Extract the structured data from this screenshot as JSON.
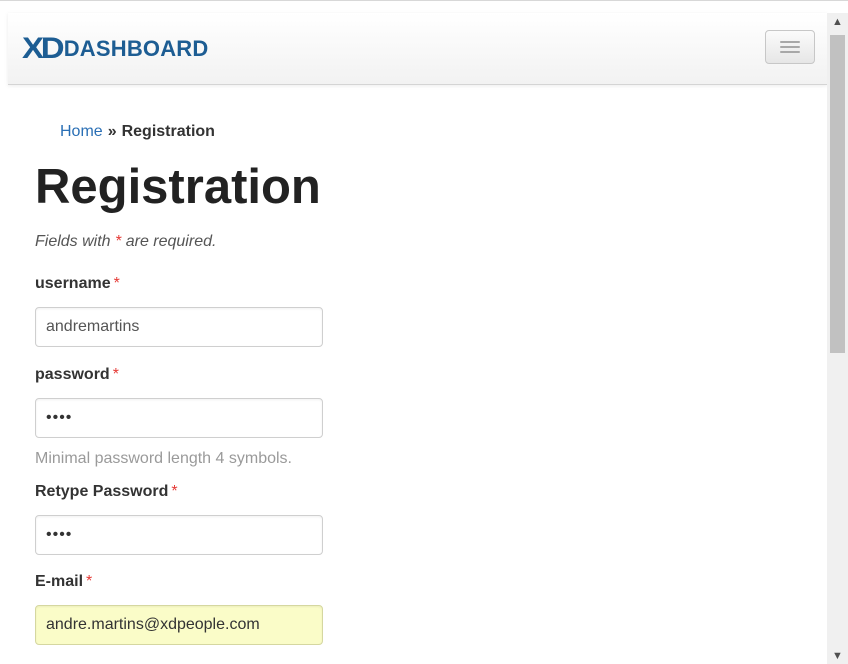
{
  "navbar": {
    "brand_mark": "XD",
    "brand_text": "DASHBOARD",
    "toggle_label": "Toggle navigation"
  },
  "breadcrumb": {
    "home": "Home",
    "separator": "»",
    "current": "Registration"
  },
  "page": {
    "title": "Registration",
    "hint_prefix": "Fields with ",
    "hint_star": "*",
    "hint_suffix": " are required."
  },
  "form": {
    "required_marker": "*",
    "username": {
      "label": "username",
      "value": "andremartins"
    },
    "password": {
      "label": "password",
      "value": "••••",
      "help": "Minimal password length 4 symbols."
    },
    "retype_password": {
      "label": "Retype Password",
      "value": "••••"
    },
    "email": {
      "label": "E-mail",
      "value": "andre.martins@xdpeople.com"
    }
  },
  "scrollbar": {
    "up_icon": "▲",
    "down_icon": "▼"
  },
  "colors": {
    "brand": "#1d5d93",
    "link": "#2a6fb5",
    "required": "#e53935",
    "autofill": "#fafcc8"
  }
}
